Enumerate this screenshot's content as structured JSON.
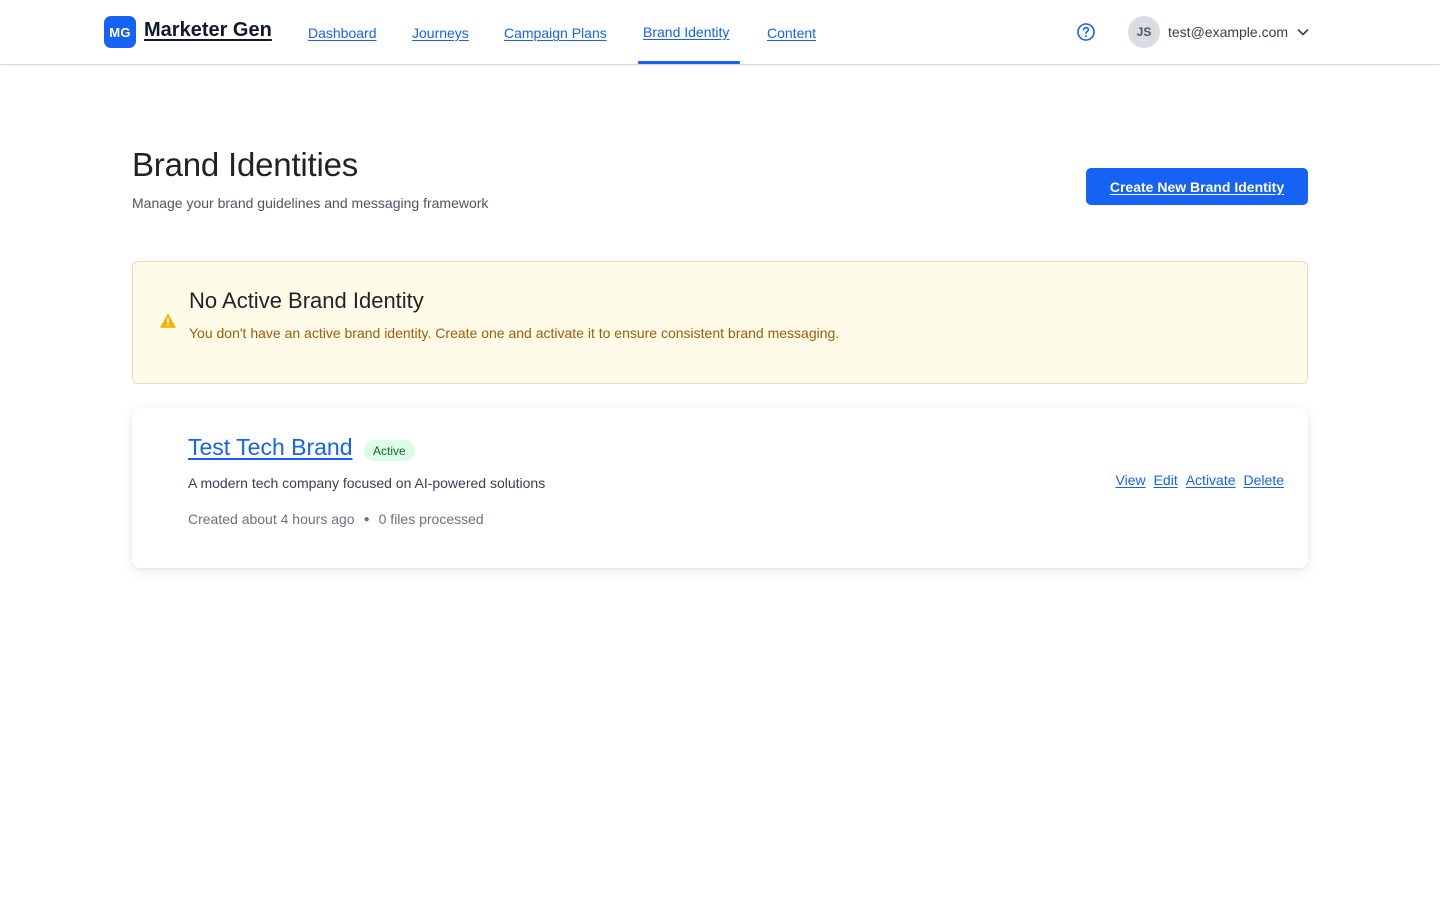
{
  "header": {
    "logo_initials": "MG",
    "app_name": "Marketer Gen",
    "nav": [
      {
        "label": "Dashboard"
      },
      {
        "label": "Journeys"
      },
      {
        "label": "Campaign Plans"
      },
      {
        "label": "Brand Identity",
        "active": true
      },
      {
        "label": "Content"
      }
    ],
    "user": {
      "initials": "JS",
      "email": "test@example.com"
    },
    "icons": {
      "help": "question-circle-icon",
      "menu": "chevron-down-icon"
    }
  },
  "page": {
    "title": "Brand Identities",
    "subtitle": "Manage your brand guidelines and messaging framework",
    "create_button": "Create New Brand Identity"
  },
  "alert": {
    "icon": "warning-triangle-icon",
    "title": "No Active Brand Identity",
    "message": "You don't have an active brand identity. Create one and activate it to ensure consistent brand messaging."
  },
  "brands": [
    {
      "name": "Test Tech Brand",
      "status": "Active",
      "description": "A modern tech company focused on AI-powered solutions",
      "created": "Created about 4 hours ago",
      "files": "0 files processed",
      "actions": [
        "View",
        "Edit",
        "Activate",
        "Delete"
      ]
    }
  ],
  "colors": {
    "accent": "#1662f4",
    "alert_bg": "#fefbe8",
    "alert_text": "#a15c07",
    "warning_icon": "#f2b705",
    "badge_bg": "#dcfce7",
    "badge_text": "#166534"
  }
}
